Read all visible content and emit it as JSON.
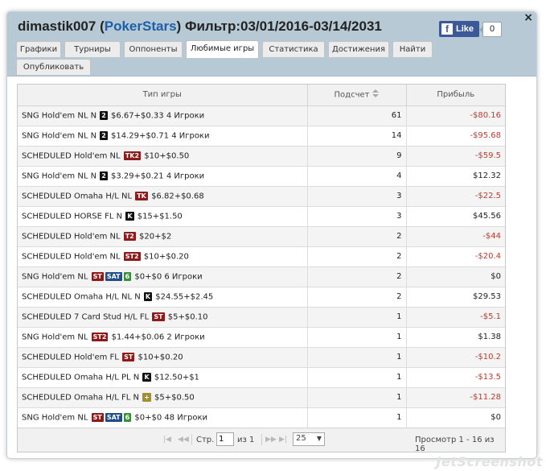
{
  "header": {
    "user": "dimastik007",
    "open_paren": "(",
    "brand": "PokerStars",
    "close_paren": ")",
    "filter": "Фильтр:03/01/2016-03/14/2031",
    "close": "×"
  },
  "facebook": {
    "like_label": "Like",
    "count": "0",
    "icon_letter": "f"
  },
  "tabs": [
    {
      "label": "Графики"
    },
    {
      "label": "Турниры"
    },
    {
      "label": "Оппоненты"
    },
    {
      "label": "Любимые игры",
      "active": true
    },
    {
      "label": "Статистика"
    },
    {
      "label": "Достижения"
    },
    {
      "label": "Найти"
    },
    {
      "label": "Опубликовать"
    }
  ],
  "columns": {
    "game": "Тип игры",
    "count": "Подсчет",
    "profit": "Прибыль"
  },
  "rows": [
    {
      "game": "SNG Hold'em NL N",
      "badges": [
        {
          "t": "2",
          "c": "blk"
        }
      ],
      "stake": "$6.67+$0.33 4 Игроки",
      "count": "61",
      "profit": "-$80.16",
      "neg": true
    },
    {
      "game": "SNG Hold'em NL N",
      "badges": [
        {
          "t": "2",
          "c": "blk"
        }
      ],
      "stake": "$14.29+$0.71 4 Игроки",
      "count": "14",
      "profit": "-$95.68",
      "neg": true
    },
    {
      "game": "SCHEDULED Hold'em NL",
      "badges": [
        {
          "t": "TK2",
          "c": "red"
        }
      ],
      "stake": "$10+$0.50",
      "count": "9",
      "profit": "-$59.5",
      "neg": true
    },
    {
      "game": "SNG Hold'em NL N",
      "badges": [
        {
          "t": "2",
          "c": "blk"
        }
      ],
      "stake": "$3.29+$0.21 4 Игроки",
      "count": "4",
      "profit": "$12.32",
      "neg": false
    },
    {
      "game": "SCHEDULED Omaha H/L NL",
      "badges": [
        {
          "t": "TK",
          "c": "red"
        }
      ],
      "stake": "$6.82+$0.68",
      "count": "3",
      "profit": "-$22.5",
      "neg": true
    },
    {
      "game": "SCHEDULED HORSE FL N",
      "badges": [
        {
          "t": "K",
          "c": "blk"
        }
      ],
      "stake": "$15+$1.50",
      "count": "3",
      "profit": "$45.56",
      "neg": false
    },
    {
      "game": "SCHEDULED Hold'em NL",
      "badges": [
        {
          "t": "T2",
          "c": "red"
        }
      ],
      "stake": "$20+$2",
      "count": "2",
      "profit": "-$44",
      "neg": true
    },
    {
      "game": "SCHEDULED Hold'em NL",
      "badges": [
        {
          "t": "ST2",
          "c": "red"
        }
      ],
      "stake": "$10+$0.20",
      "count": "2",
      "profit": "-$20.4",
      "neg": true
    },
    {
      "game": "SNG Hold'em NL",
      "badges": [
        {
          "t": "ST",
          "c": "red"
        },
        {
          "t": "SAT",
          "c": "blue"
        },
        {
          "t": "6",
          "c": "grn"
        }
      ],
      "stake": "$0+$0 6 Игроки",
      "count": "2",
      "profit": "$0",
      "neg": false
    },
    {
      "game": "SCHEDULED Omaha H/L NL N",
      "badges": [
        {
          "t": "K",
          "c": "blk"
        }
      ],
      "stake": "$24.55+$2.45",
      "count": "2",
      "profit": "$29.53",
      "neg": false
    },
    {
      "game": "SCHEDULED 7 Card Stud H/L FL",
      "badges": [
        {
          "t": "ST",
          "c": "red"
        }
      ],
      "stake": "$5+$0.10",
      "count": "1",
      "profit": "-$5.1",
      "neg": true
    },
    {
      "game": "SNG Hold'em NL",
      "badges": [
        {
          "t": "ST2",
          "c": "red"
        }
      ],
      "stake": "$1.44+$0.06 2 Игроки",
      "count": "1",
      "profit": "$1.38",
      "neg": false
    },
    {
      "game": "SCHEDULED Hold'em FL",
      "badges": [
        {
          "t": "ST",
          "c": "red"
        }
      ],
      "stake": "$10+$0.20",
      "count": "1",
      "profit": "-$10.2",
      "neg": true
    },
    {
      "game": "SCHEDULED Omaha H/L PL N",
      "badges": [
        {
          "t": "K",
          "c": "blk"
        }
      ],
      "stake": "$12.50+$1",
      "count": "1",
      "profit": "-$13.5",
      "neg": true
    },
    {
      "game": "SCHEDULED Omaha H/L FL N",
      "badges": [
        {
          "t": "+",
          "c": "ylw"
        }
      ],
      "stake": "$5+$0.50",
      "count": "1",
      "profit": "-$11.28",
      "neg": true
    },
    {
      "game": "SNG Hold'em NL",
      "badges": [
        {
          "t": "ST",
          "c": "red"
        },
        {
          "t": "SAT",
          "c": "blue"
        },
        {
          "t": "6",
          "c": "grn"
        }
      ],
      "stake": "$0+$0 48 Игроки",
      "count": "1",
      "profit": "$0",
      "neg": false
    }
  ],
  "pager": {
    "first": "|◀",
    "prev": "◀◀",
    "page_label": "Стр.",
    "page_value": "1",
    "of_label": "из 1",
    "next": "▶▶",
    "last": "▶|",
    "per_page": "25",
    "view_text": "Просмотр 1 - 16 из 16"
  },
  "watermark": "JetScreenshot",
  "colors": {
    "header_bg": "#b7c9d5",
    "brand": "#1d5fa8",
    "negative": "#c0392b",
    "facebook": "#3b5998"
  }
}
